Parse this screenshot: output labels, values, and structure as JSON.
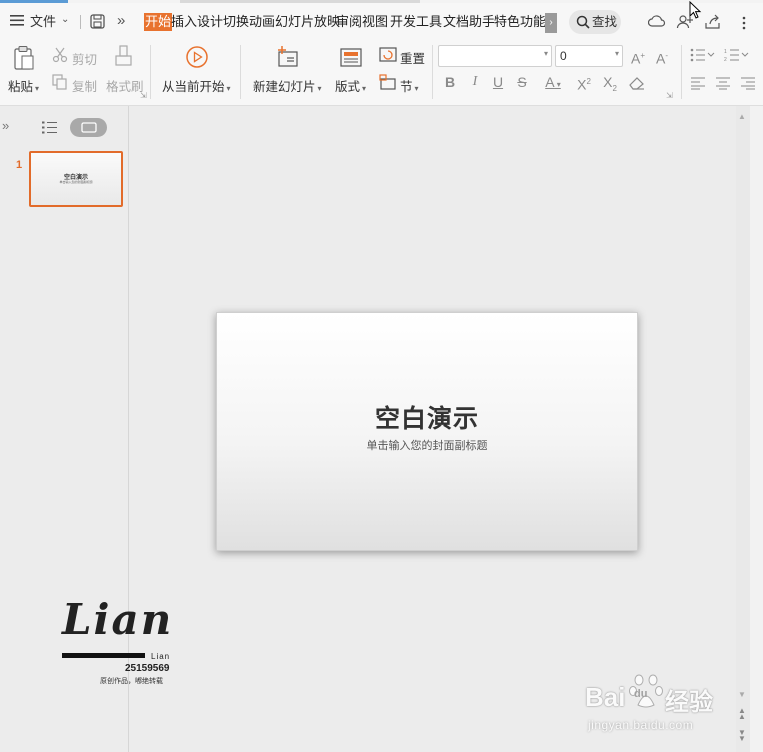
{
  "menubar": {
    "file_label": "文件",
    "tabs": [
      "开始",
      "插入",
      "设计",
      "切换",
      "动画",
      "幻灯片放映",
      "审阅",
      "视图",
      "开发工具",
      "文档助手",
      "特色功能"
    ],
    "search_label": "查找"
  },
  "ribbon": {
    "paste": "粘贴",
    "cut": "剪切",
    "copy": "复制",
    "format_painter": "格式刷",
    "start_from_current": "从当前开始",
    "new_slide": "新建幻灯片",
    "layout": "版式",
    "reset": "重置",
    "section": "节",
    "font_size_value": "0",
    "font_name_value": ""
  },
  "slide_panel": {
    "slide_number": "1",
    "thumb_title": "空白演示",
    "thumb_sub": "单击输入您的封面副标题"
  },
  "slide": {
    "title": "空白演示",
    "subtitle": "单击输入您的封面副标题"
  },
  "watermark": {
    "big": "Lian",
    "small": "Lian",
    "number": "25159569",
    "note": "原创作品，嘟绝转载",
    "baidu_text": "Bai",
    "baidu_du": "du",
    "baidu_jingyan": "经验",
    "baidu_url": "jingyan.baidu.com"
  },
  "colors": {
    "accent": "#e8722e",
    "thumb_border": "#e26b2a"
  }
}
